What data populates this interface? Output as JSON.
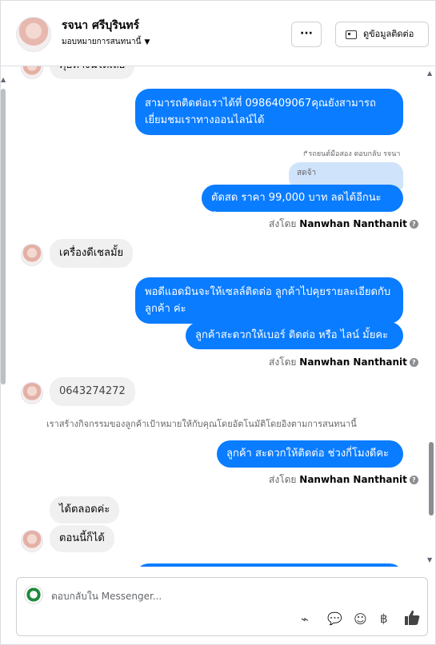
{
  "header": {
    "name": "รจนา ศรีบุรินทร์",
    "assigned": "มอบหมายการสนทนานี้",
    "more_label": "···",
    "contact_label": "ดูข้อมูลติดต่อ"
  },
  "messages": {
    "top_partial": "คุยทางนี้ได้เลย",
    "out1": "สามารถติดต่อเราได้ที่ 0986409067คุณยังสามารถเยี่ยมชมเราทางออนไลน์ได้",
    "reply_meta": "รถยนต์มือสอง ตอบกลับ รจนา",
    "quote": "สดจ้า",
    "out2": "ตัดสด ราคา 99,000 บาท ลดได้อีกนะคะ",
    "sent_by_label": "ส่งโดย",
    "sender": "Nanwhan Nanthanit",
    "in1": "เครื่องดีเชลมั้ย",
    "out3": "พอดีแอดมินจะให้เซลล์ติดต่อ ลูกค้าไปคุยรายละเอียดกับลูกค้า ค่ะ",
    "out4": "ลูกค้าสะดวกให้เบอร์ ติดต่อ หรือ ไลน์ มั้ยคะ",
    "in2": "0643274272",
    "system": "เราสร้างกิจกรรมของลูกค้าเป้าหมายให้กับคุณโดยอัตโนมัติโดยอิงตามการสนทนานี้",
    "out5": "ลูกค้า สะดวกให้ติดต่อ ช่วงกี่โมงดีคะ",
    "in3": "ได้ตลอดค่ะ",
    "in4": "ตอนนี้ก็ได้"
  },
  "composer": {
    "placeholder": "ตอบกลับใน Messenger...",
    "tools": [
      "attach-icon",
      "message-icon",
      "emoji-icon",
      "baht-icon",
      "like-icon"
    ]
  },
  "colors": {
    "outgoing": "#0a7cff",
    "incoming": "#f0f0f0",
    "quote": "#cfe3fb"
  }
}
